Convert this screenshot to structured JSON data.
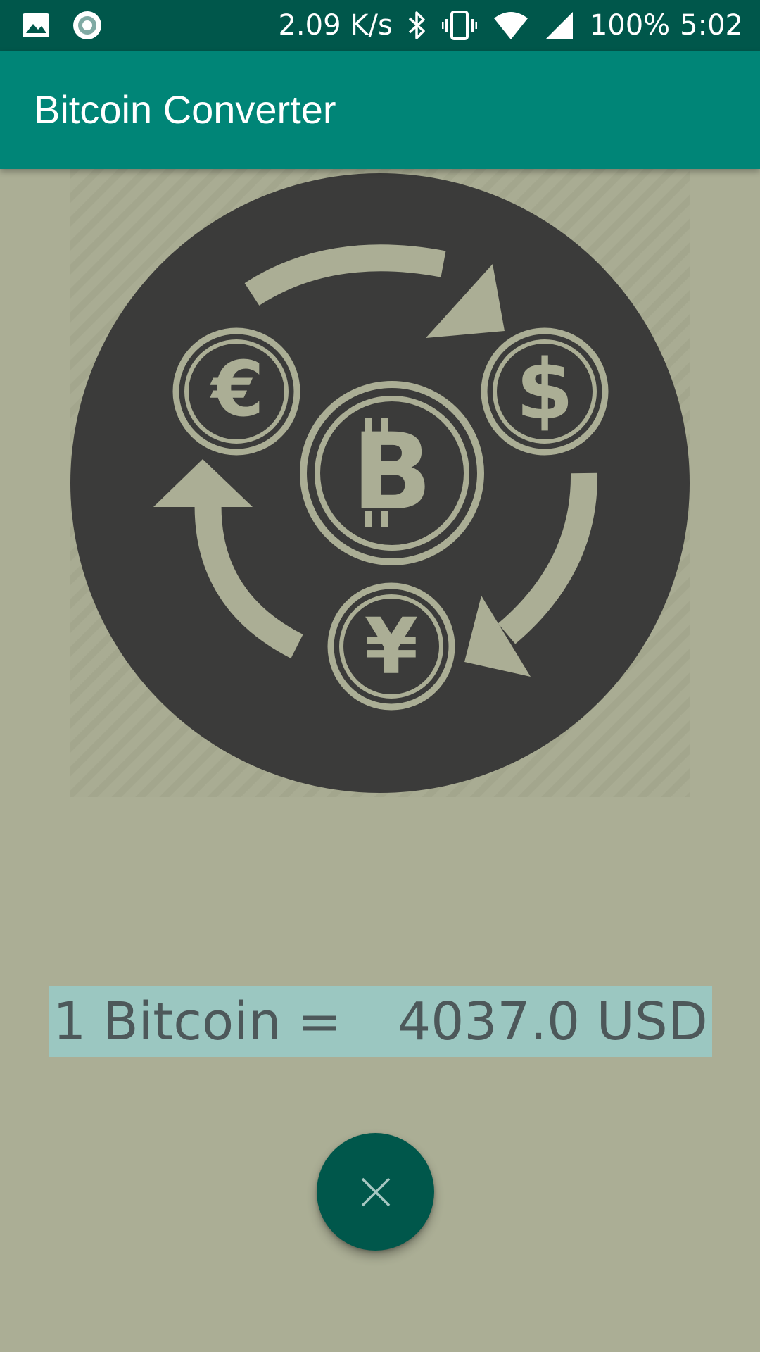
{
  "status_bar": {
    "net_speed": "2.09 K/s",
    "battery": "100%",
    "time": "5:02",
    "icons": [
      "image-icon",
      "record-icon",
      "bluetooth-icon",
      "vibrate-icon",
      "wifi-icon",
      "signal-icon"
    ]
  },
  "app_bar": {
    "title": "Bitcoin Converter"
  },
  "hero": {
    "icon": "currency-exchange-icon",
    "currencies": [
      "euro-icon",
      "dollar-icon",
      "bitcoin-icon",
      "yen-icon"
    ]
  },
  "rate": {
    "label": "1 Bitcoin =",
    "value": "4037.0 USD"
  },
  "fab": {
    "icon": "close-icon"
  },
  "colors": {
    "status_bar": "#00574b",
    "app_bar": "#008577",
    "background": "#abae95",
    "rate_box": "#9bc7c1",
    "rate_text": "#4d585a",
    "fab": "#00574b",
    "emblem_circle": "#3b3b3a",
    "emblem_mark": "#abae95"
  }
}
